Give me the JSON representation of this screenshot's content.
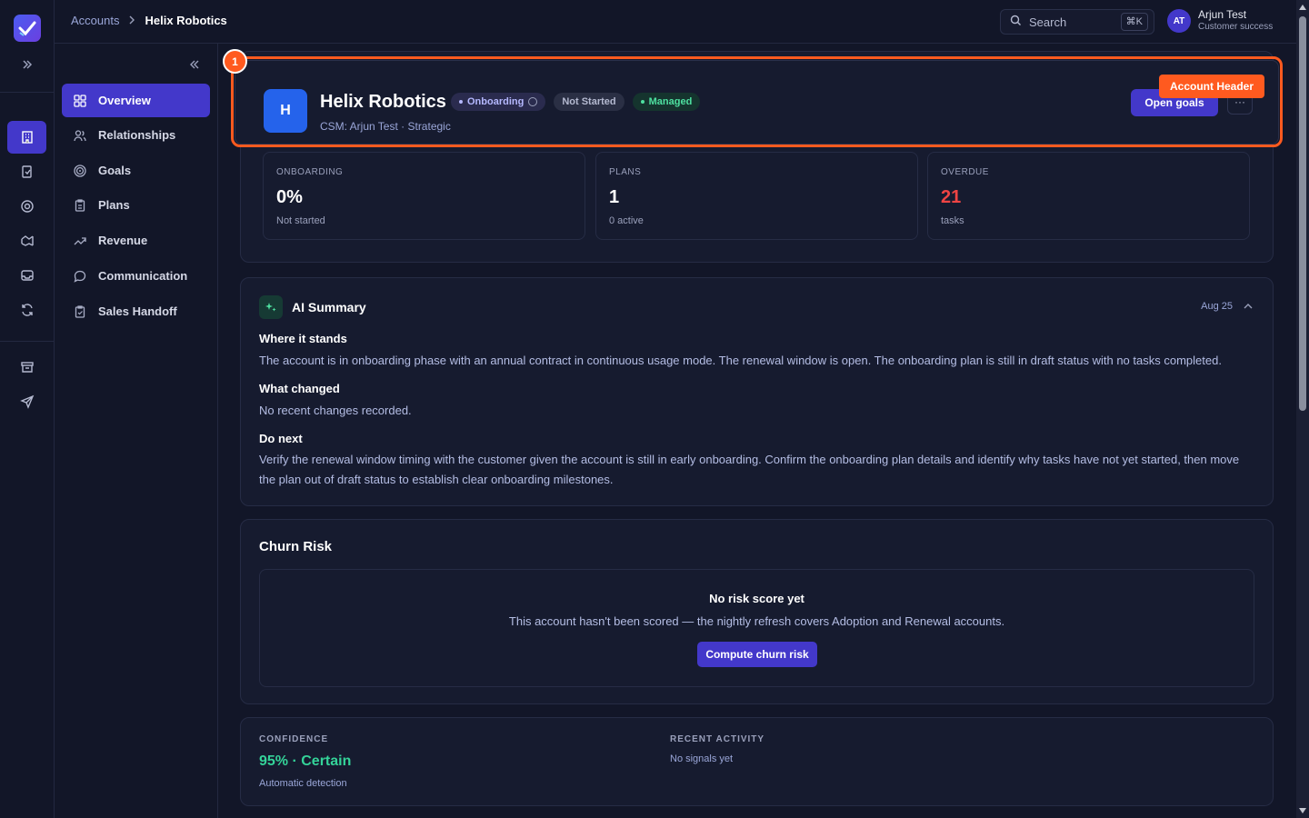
{
  "breadcrumb": {
    "parent": "Accounts",
    "current": "Helix Robotics"
  },
  "search": {
    "placeholder": "Search",
    "shortcut": "⌘K"
  },
  "user": {
    "initials": "AT",
    "name": "Arjun Test",
    "role": "Customer success"
  },
  "rail": {
    "icons": [
      "building-icon",
      "file-check-icon",
      "target-icon",
      "handshake-icon",
      "inbox-icon",
      "refresh-icon",
      "archive-icon",
      "send-icon"
    ]
  },
  "sidebar": {
    "items": [
      {
        "label": "Overview",
        "icon": "grid-icon"
      },
      {
        "label": "Relationships",
        "icon": "users-icon"
      },
      {
        "label": "Goals",
        "icon": "target-icon"
      },
      {
        "label": "Plans",
        "icon": "clipboard-icon"
      },
      {
        "label": "Revenue",
        "icon": "trend-up-icon"
      },
      {
        "label": "Communication",
        "icon": "chat-icon"
      },
      {
        "label": "Sales Handoff",
        "icon": "clipboard-check-icon"
      }
    ]
  },
  "account": {
    "initial": "H",
    "name": "Helix Robotics",
    "subtitle": "CSM: Arjun Test · Strategic",
    "badges": {
      "phase": "Onboarding",
      "status": "Not Started",
      "mode": "Managed"
    },
    "open_goals": "Open goals",
    "more": "···"
  },
  "highlight": {
    "number": "1",
    "tag": "Account Header",
    "color": "#ff5a1f"
  },
  "stats": [
    {
      "label": "ONBOARDING",
      "value": "0%",
      "sub": "Not started"
    },
    {
      "label": "PLANS",
      "value": "1",
      "sub": "0 active"
    },
    {
      "label": "OVERDUE",
      "value": "21",
      "sub": "tasks"
    }
  ],
  "ai_summary": {
    "title": "AI Summary",
    "date": "Aug 25",
    "sections": [
      {
        "heading": "Where it stands",
        "text": "The account is in onboarding phase with an annual contract in continuous usage mode. The renewal window is open. The onboarding plan is still in draft status with no tasks completed."
      },
      {
        "heading": "What changed",
        "text": "No recent changes recorded."
      },
      {
        "heading": "Do next",
        "text": "Verify the renewal window timing with the customer given the account is still in early onboarding. Confirm the onboarding plan details and identify why tasks have not yet started, then move the plan out of draft status to establish clear onboarding milestones."
      }
    ]
  },
  "churn": {
    "title": "Churn Risk",
    "empty_title": "No risk score yet",
    "empty_text": "This account hasn't been scored — the nightly refresh covers Adoption and Renewal accounts.",
    "button": "Compute churn risk"
  },
  "confidence": {
    "label": "CONFIDENCE",
    "value": "95% · Certain",
    "sub": "Automatic detection",
    "activity_label": "RECENT ACTIVITY",
    "activity_value": "No signals yet"
  },
  "colors": {
    "accent": "#4338ca",
    "background": "#121628",
    "danger": "#ef4444",
    "success": "#34d399"
  }
}
